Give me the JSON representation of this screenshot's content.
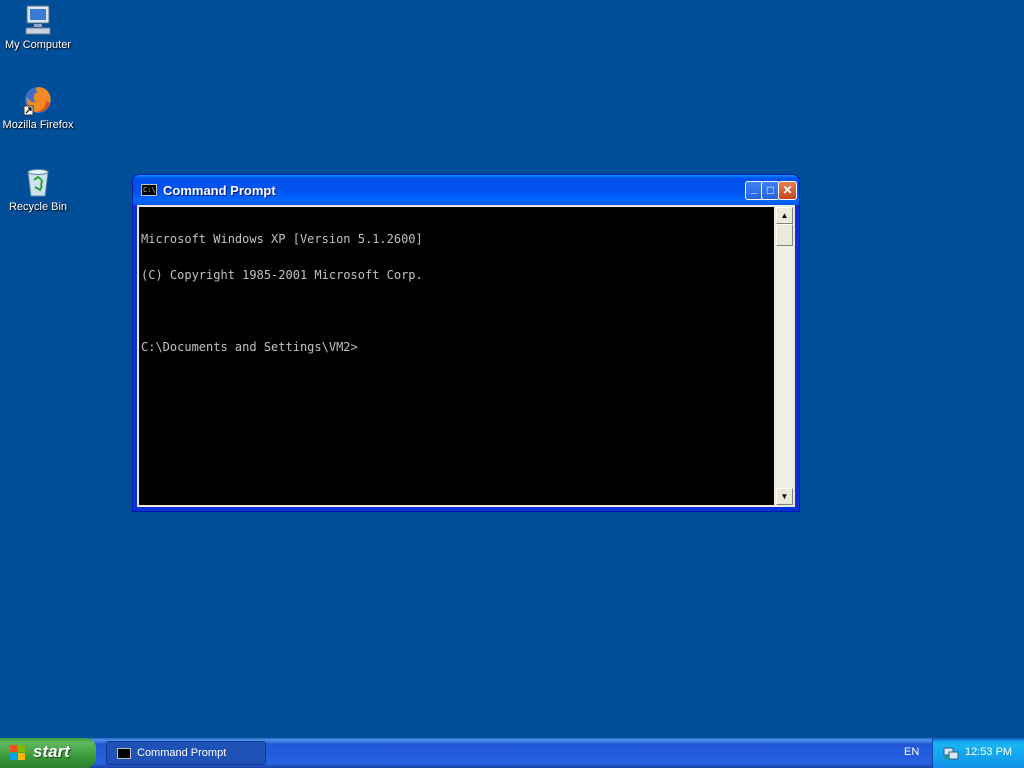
{
  "desktop": {
    "icons": [
      {
        "label": "My Computer"
      },
      {
        "label": "Mozilla Firefox"
      },
      {
        "label": "Recycle Bin"
      }
    ]
  },
  "window": {
    "title": "Command Prompt",
    "title_icon_text": "C:\\",
    "buttons": {
      "minimize": "_",
      "maximize": "□",
      "close": "✕"
    },
    "console_lines": [
      "Microsoft Windows XP [Version 5.1.2600]",
      "(C) Copyright 1985-2001 Microsoft Corp.",
      "",
      "C:\\Documents and Settings\\VM2>"
    ],
    "scroll_up": "▲",
    "scroll_down": "▼"
  },
  "taskbar": {
    "start_label": "start",
    "task_button_label": "Command Prompt",
    "language": "EN",
    "clock": "12:53 PM"
  },
  "colors": {
    "desktop": "#004E98",
    "titlebar": "#0053EE",
    "console_bg": "#000000",
    "console_fg": "#C0C0C0",
    "start_green": "#3C9A3C",
    "tray": "#139EE9"
  },
  "icon_names": [
    "my-computer-icon",
    "firefox-icon",
    "recycle-bin-icon",
    "network-tray-icon",
    "windows-flag-icon"
  ]
}
